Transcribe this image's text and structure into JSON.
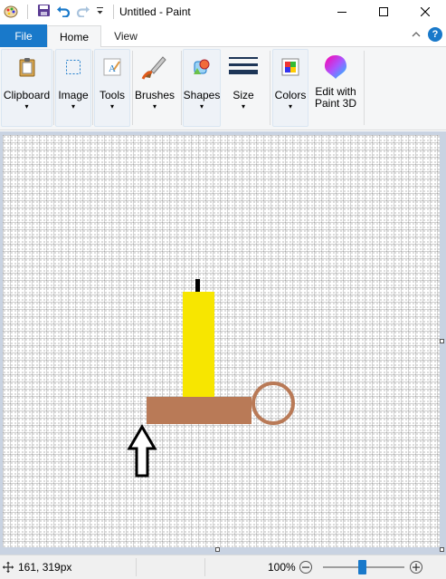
{
  "window": {
    "title": "Untitled - Paint",
    "controls": {
      "minimize": "—",
      "maximize": "☐",
      "close": "✕"
    }
  },
  "tabs": [
    {
      "label": "File"
    },
    {
      "label": "Home"
    },
    {
      "label": "View"
    }
  ],
  "ribbon": {
    "tools": [
      {
        "label": "Clipboard",
        "icon": "clipboard-icon"
      },
      {
        "label": "Image",
        "icon": "select-icon"
      },
      {
        "label": "Tools",
        "icon": "tools-icon"
      },
      {
        "label": "Brushes",
        "icon": "brush-icon"
      },
      {
        "label": "Shapes",
        "icon": "shapes-icon"
      },
      {
        "label": "Size",
        "icon": "size-icon"
      },
      {
        "label": "Colors",
        "icon": "colors-icon"
      },
      {
        "label": "Edit with Paint 3D",
        "icon": "paint3d-icon"
      }
    ],
    "dropdown_arrow": "▾"
  },
  "canvas": {
    "colors": {
      "candle": "#f7e600",
      "wick": "#000000",
      "holder": "#b97a57",
      "arrow_stroke": "#000000",
      "background": "#ffffff"
    }
  },
  "status": {
    "cursor_position": "161, 319px",
    "zoom": "100%",
    "zoom_fraction": 0.5
  }
}
